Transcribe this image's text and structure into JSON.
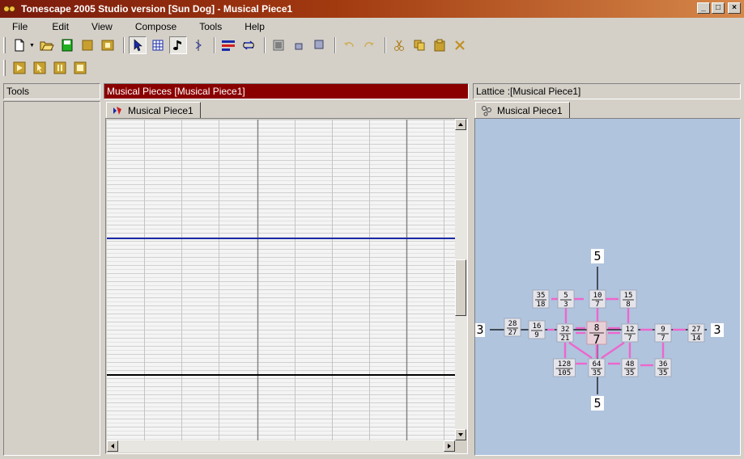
{
  "window": {
    "title": "Tonescape 2005 Studio  version [Sun Dog]  -  Musical Piece1",
    "minimize": "_",
    "maximize": "□",
    "close": "×"
  },
  "menu": [
    "File",
    "Edit",
    "View",
    "Compose",
    "Tools",
    "Help"
  ],
  "panels": {
    "tools": {
      "title": "Tools"
    },
    "musical_pieces": {
      "title": "Musical Pieces  [Musical Piece1]",
      "tab": "Musical Piece1"
    },
    "lattice": {
      "title": "Lattice :[Musical Piece1]",
      "tab": "Musical Piece1"
    }
  },
  "colors": {
    "title_start": "#7a1a0c",
    "title_end": "#d6884a",
    "pieces_header": "#8a0000",
    "lattice_bg": "#b0c4de",
    "link_pink": "#ee66cc",
    "accent_blue": "#1a2aa8"
  },
  "lattice": {
    "axis_labels": {
      "top": "5",
      "bottom": "5",
      "left": "3",
      "right": "3"
    },
    "nodes": [
      {
        "num": "35",
        "den": "18"
      },
      {
        "num": "5",
        "den": "3"
      },
      {
        "num": "10",
        "den": "7"
      },
      {
        "num": "15",
        "den": "8"
      },
      {
        "num": "28",
        "den": "27"
      },
      {
        "num": "16",
        "den": "9"
      },
      {
        "num": "32",
        "den": "21"
      },
      {
        "num": "8",
        "den": "7"
      },
      {
        "num": "12",
        "den": "7"
      },
      {
        "num": "9",
        "den": "7"
      },
      {
        "num": "27",
        "den": "14"
      },
      {
        "num": "128",
        "den": "105"
      },
      {
        "num": "64",
        "den": "35"
      },
      {
        "num": "48",
        "den": "35"
      },
      {
        "num": "36",
        "den": "35"
      }
    ]
  }
}
